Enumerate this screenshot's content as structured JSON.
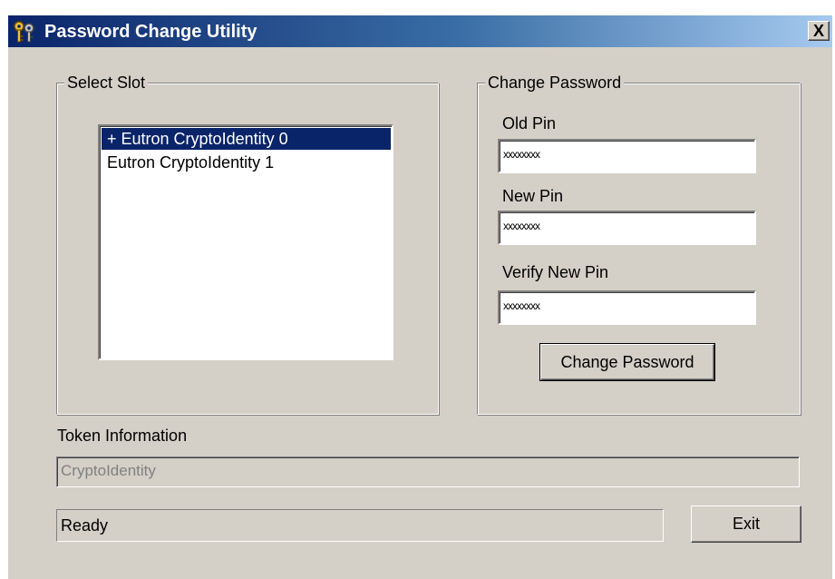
{
  "window": {
    "title": "Password Change Utility",
    "close_label": "X",
    "title_icon": "keys-icon"
  },
  "select_slot": {
    "legend": "Select Slot",
    "items": [
      {
        "label": "+ Eutron CryptoIdentity 0",
        "selected": true
      },
      {
        "label": "Eutron CryptoIdentity 1",
        "selected": false
      }
    ]
  },
  "change_password": {
    "legend": "Change Password",
    "old_pin_label": "Old  Pin",
    "old_pin_value": "xxxxxxxx",
    "new_pin_label": "New Pin",
    "new_pin_value": "xxxxxxxx",
    "verify_pin_label": "Verify New Pin",
    "verify_pin_value": "xxxxxxxx",
    "button_label": "Change Password"
  },
  "token_info": {
    "label": "Token Information",
    "value": "CryptoIdentity"
  },
  "status": {
    "text": "Ready"
  },
  "exit_label": "Exit",
  "colors": {
    "face": "#d4d0c8",
    "titlebar_start": "#0a246a",
    "titlebar_end": "#a6caf0",
    "selection": "#0a246a"
  }
}
